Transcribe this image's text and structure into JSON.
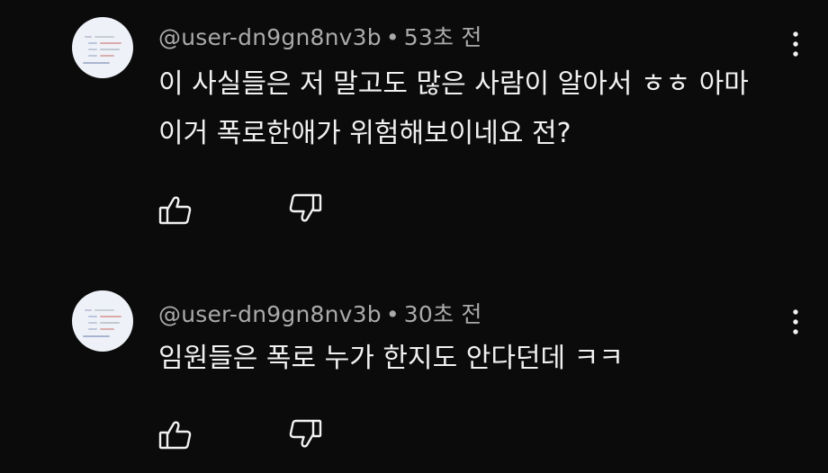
{
  "comments": [
    {
      "author": "@user-dn9gn8nv3b",
      "separator": "•",
      "time": "53초 전",
      "text": "이 사실들은 저 말고도 많은 사람이 알아서 ㅎㅎ 아마 이거 폭로한애가 위험해보이네요 전?"
    },
    {
      "author": "@user-dn9gn8nv3b",
      "separator": "•",
      "time": "30초 전",
      "text": "임원들은 폭로 누가 한지도 안다던데 ㅋㅋ"
    }
  ],
  "icons": {
    "like": "thumbs-up-icon",
    "dislike": "thumbs-down-icon",
    "more": "more-vert-icon"
  },
  "colors": {
    "background": "#0b0b0b",
    "text": "#f1f1f1",
    "meta": "#aaaaaa",
    "avatar_bg": "#eef2f8"
  }
}
